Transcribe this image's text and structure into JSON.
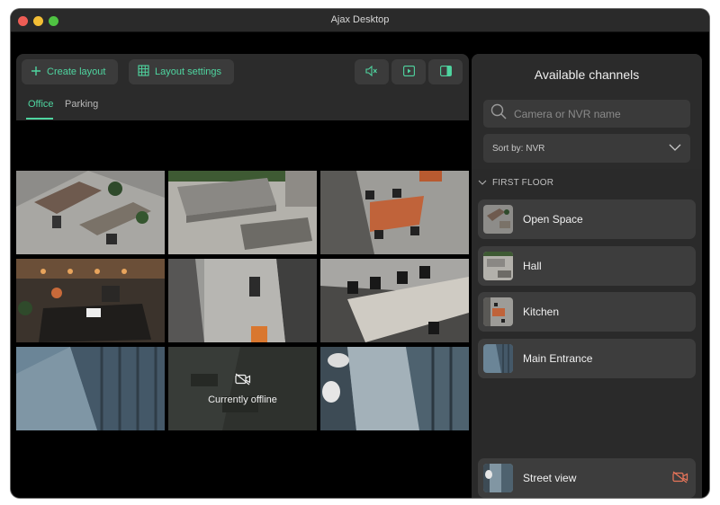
{
  "window": {
    "title": "Ajax Desktop"
  },
  "toolbar": {
    "create_label": "Create layout",
    "settings_label": "Layout settings",
    "icons": [
      "mute-icon",
      "play-icon",
      "side-panel-icon"
    ]
  },
  "tabs": [
    {
      "label": "Office",
      "active": true
    },
    {
      "label": "Parking",
      "active": false
    }
  ],
  "grid": {
    "offline_text": "Currently offline"
  },
  "side": {
    "title": "Available channels",
    "search_placeholder": "Camera or NVR name",
    "sort_label": "Sort by: NVR",
    "section": "FIRST FLOOR",
    "channels": [
      {
        "name": "Open Space"
      },
      {
        "name": "Hall"
      },
      {
        "name": "Kitchen"
      },
      {
        "name": "Main Entrance"
      }
    ],
    "bottom_channel": {
      "name": "Street view",
      "status_icon": "camera-offline-icon"
    }
  },
  "colors": {
    "accent": "#4fd5a0",
    "offline": "#e8755a"
  }
}
